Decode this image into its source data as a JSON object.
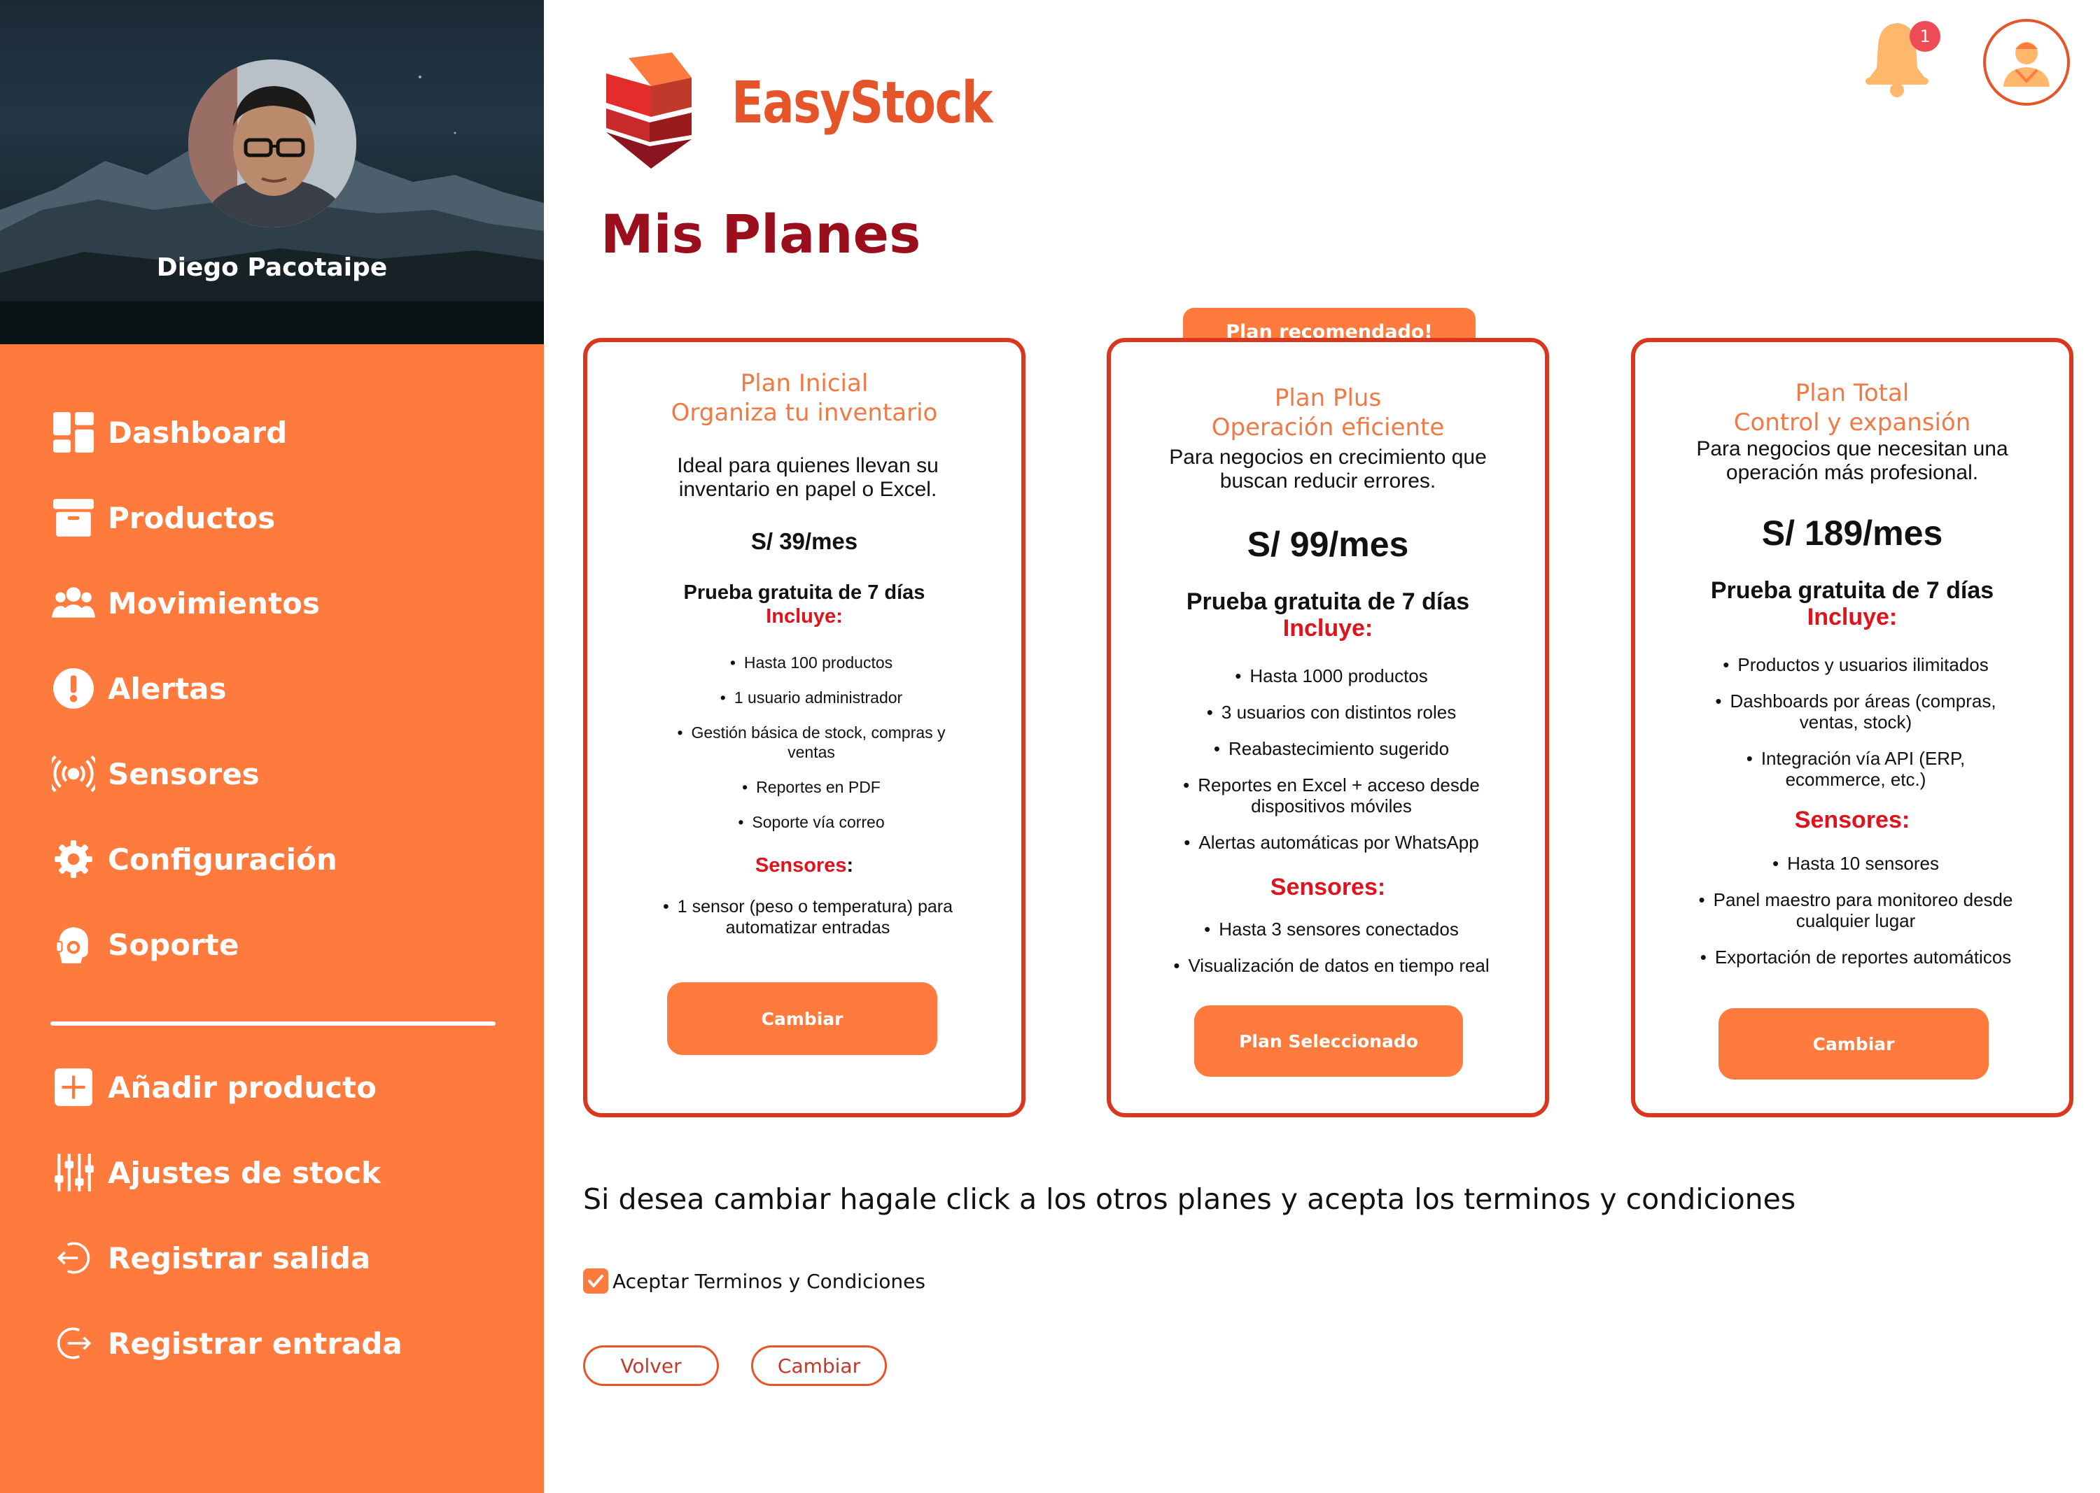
{
  "user": {
    "name": "Diego Pacotaipe"
  },
  "brand": {
    "name": "EasyStock"
  },
  "page": {
    "title": "Mis Planes"
  },
  "notifications": {
    "count": "1"
  },
  "sidebar": {
    "items": [
      {
        "label": "Dashboard",
        "icon": "dashboard-icon"
      },
      {
        "label": "Productos",
        "icon": "archive-box-icon"
      },
      {
        "label": "Movimientos",
        "icon": "users-group-icon"
      },
      {
        "label": "Alertas",
        "icon": "alert-icon"
      },
      {
        "label": "Sensores",
        "icon": "sensor-wave-icon"
      },
      {
        "label": "Configuración",
        "icon": "gear-icon"
      },
      {
        "label": "Soporte",
        "icon": "support-headset-icon"
      }
    ],
    "actions": [
      {
        "label": "Añadir producto",
        "icon": "add-square-icon"
      },
      {
        "label": "Ajustes de stock",
        "icon": "sliders-icon"
      },
      {
        "label": "Registrar salida",
        "icon": "exit-icon"
      },
      {
        "label": "Registrar entrada",
        "icon": "entry-icon"
      }
    ]
  },
  "recommended_label": "Plan recomendado!",
  "plans": [
    {
      "title1": "Plan Inicial",
      "title2": "Organiza tu inventario",
      "desc": "Ideal para quienes llevan su inventario en papel o Excel.",
      "price": "S/ 39/mes",
      "trial": "Prueba gratuita de 7 días",
      "includes_label": "Incluye:",
      "features": [
        "Hasta 100 productos",
        "1 usuario administrador",
        "Gestión básica de stock, compras y ventas",
        "Reportes en PDF",
        "Soporte vía correo"
      ],
      "sensors_label": "Sensores",
      "sensors_colon": ":",
      "sensors": [
        "1 sensor (peso o temperatura) para automatizar entradas"
      ],
      "button": "Cambiar"
    },
    {
      "title1": "Plan Plus",
      "title2": "Operación eficiente",
      "desc": "Para negocios en crecimiento que buscan reducir errores.",
      "price": "S/ 99/mes",
      "trial": "Prueba gratuita de 7 días",
      "includes_label": "Incluye:",
      "features": [
        "Hasta 1000 productos",
        "3 usuarios con distintos roles",
        "Reabastecimiento sugerido",
        "Reportes en Excel + acceso desde dispositivos móviles",
        "Alertas automáticas por WhatsApp"
      ],
      "sensors_label": "Sensores:",
      "sensors": [
        "Hasta 3 sensores conectados",
        "Visualización de datos en tiempo real"
      ],
      "button": "Plan Seleccionado"
    },
    {
      "title1": "Plan Total",
      "title2": "Control y expansión",
      "desc": "Para negocios que necesitan una operación más profesional.",
      "price": "S/ 189/mes",
      "trial": "Prueba gratuita de 7 días",
      "includes_label": "Incluye:",
      "features": [
        "Productos y usuarios ilimitados",
        "Dashboards por áreas (compras, ventas, stock)",
        "Integración vía API (ERP, ecommerce, etc.)"
      ],
      "sensors_label": "Sensores:",
      "sensors": [
        "Hasta 10 sensores",
        "Panel maestro para monitoreo desde cualquier lugar",
        "Exportación de reportes automáticos"
      ],
      "button": "Cambiar"
    }
  ],
  "instructions": "Si desea cambiar hagale click a los otros planes y acepta los terminos y condiciones",
  "terms": {
    "label": "Aceptar Terminos y Condiciones",
    "checked": true
  },
  "buttons": {
    "back": "Volver",
    "change": "Cambiar"
  },
  "colors": {
    "accent": "#ff7a3d",
    "title": "#9b0e1c",
    "brand": "#e6542a",
    "card_border": "#d9381e",
    "highlight_red": "#e0121c"
  }
}
